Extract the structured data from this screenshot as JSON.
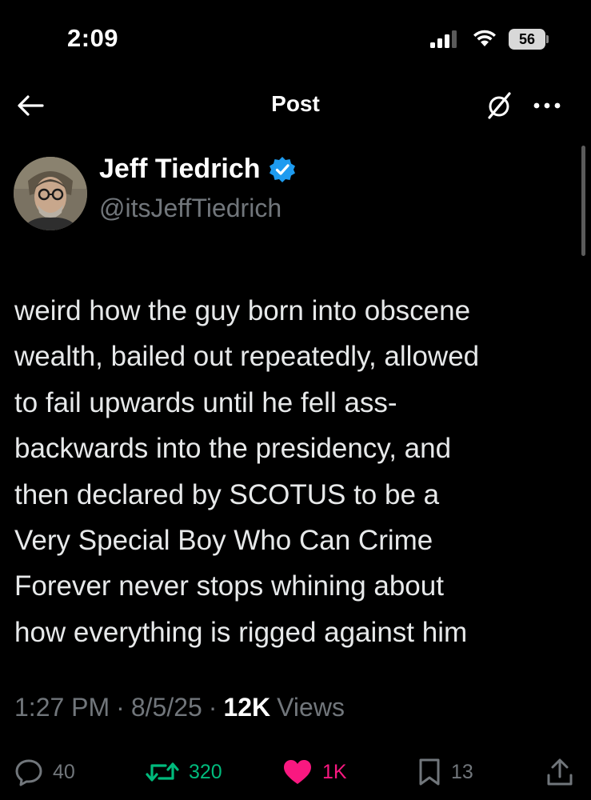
{
  "status_bar": {
    "time": "2:09",
    "battery": "56"
  },
  "header": {
    "title": "Post"
  },
  "author": {
    "name": "Jeff Tiedrich",
    "handle": "@itsJeffTiedrich",
    "verified": true
  },
  "tweet": {
    "text": "weird how the guy born into obscene\nwealth, bailed out repeatedly, allowed\nto fail upwards until he fell ass-\nbackwards into the presidency, and\nthen declared by SCOTUS to be a\nVery Special Boy Who Can Crime\nForever never stops whining about\nhow everything is rigged against him",
    "time": "1:27 PM",
    "date": "8/5/25",
    "views_count": "12K",
    "views_label": "Views"
  },
  "actions": {
    "replies": "40",
    "reposts": "320",
    "likes": "1K",
    "bookmarks": "13"
  },
  "colors": {
    "background": "#000000",
    "text": "#e7e9ea",
    "muted": "#71767b",
    "verified": "#1d9bf0",
    "repost": "#00ba7c",
    "like": "#f91880"
  },
  "icons": [
    "signal-icon",
    "wifi-icon",
    "battery-icon",
    "back-arrow-icon",
    "grok-icon",
    "more-icon",
    "verified-badge-icon",
    "reply-icon",
    "repost-icon",
    "heart-icon",
    "bookmark-icon",
    "share-icon"
  ]
}
